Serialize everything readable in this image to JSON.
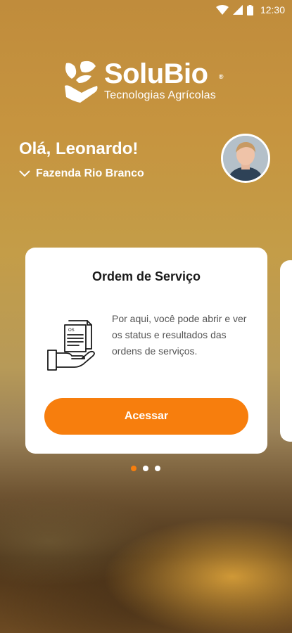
{
  "status_bar": {
    "time": "12:30",
    "icons": [
      "wifi-icon",
      "cell-signal-icon",
      "battery-icon"
    ]
  },
  "logo": {
    "wordmark": "SoluBio",
    "registered": "®",
    "tagline": "Tecnologias Agrícolas"
  },
  "header": {
    "greeting": "Olá, Leonardo!",
    "farm_selector": "Fazenda Rio Branco"
  },
  "carousel": {
    "cards": [
      {
        "title": "Ordem de Serviço",
        "description": "Por aqui, você pode abrir e ver os status e resultados das ordens de serviços.",
        "button_label": "Acessar",
        "icon": "service-order-document-hand-icon"
      }
    ],
    "pages": 3,
    "active_page": 1
  },
  "colors": {
    "accent": "#f77e0d",
    "card_bg": "#ffffff",
    "text_dark": "#1a1a1a"
  }
}
